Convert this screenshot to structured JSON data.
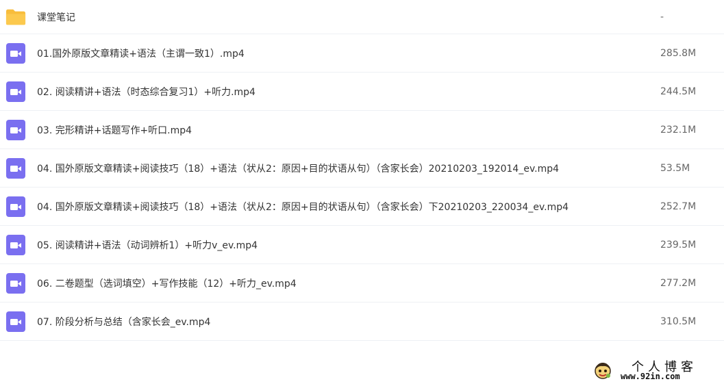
{
  "colors": {
    "folder": "#fcc94e",
    "video_icon": "#7a6ff0",
    "divider": "#eef0f4"
  },
  "files": [
    {
      "type": "folder",
      "icon": "folder-icon",
      "name": "课堂笔记",
      "size": "-"
    },
    {
      "type": "video",
      "icon": "video-file-icon",
      "name": "01.国外原版文章精读+语法（主谓一致1）.mp4",
      "size": "285.8M"
    },
    {
      "type": "video",
      "icon": "video-file-icon",
      "name": "02. 阅读精讲+语法（时态综合复习1）+听力.mp4",
      "size": "244.5M"
    },
    {
      "type": "video",
      "icon": "video-file-icon",
      "name": "03. 完形精讲+话题写作+听口.mp4",
      "size": "232.1M"
    },
    {
      "type": "video",
      "icon": "video-file-icon",
      "name": "04. 国外原版文章精读+阅读技巧（18）+语法（状从2：原因+目的状语从句）（含家长会）20210203_192014_ev.mp4",
      "size": "53.5M"
    },
    {
      "type": "video",
      "icon": "video-file-icon",
      "name": "04. 国外原版文章精读+阅读技巧（18）+语法（状从2：原因+目的状语从句）（含家长会）下20210203_220034_ev.mp4",
      "size": "252.7M"
    },
    {
      "type": "video",
      "icon": "video-file-icon",
      "name": "05. 阅读精讲+语法（动词辨析1）+听力v_ev.mp4",
      "size": "239.5M"
    },
    {
      "type": "video",
      "icon": "video-file-icon",
      "name": "06. 二卷题型（选词填空）+写作技能（12）+听力_ev.mp4",
      "size": "277.2M"
    },
    {
      "type": "video",
      "icon": "video-file-icon",
      "name": "07. 阶段分析与总结（含家长会_ev.mp4",
      "size": "310.5M"
    }
  ],
  "watermark": {
    "title": "个人博客",
    "url": "www.92in.com",
    "icon": "avatar-icon"
  }
}
